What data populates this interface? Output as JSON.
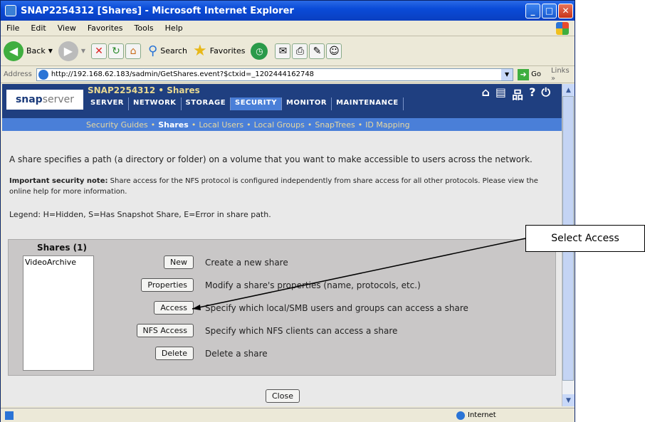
{
  "window": {
    "title": "SNAP2254312 [Shares] - Microsoft Internet Explorer"
  },
  "menu": [
    "File",
    "Edit",
    "View",
    "Favorites",
    "Tools",
    "Help"
  ],
  "toolbar": {
    "back": "Back",
    "search": "Search",
    "favorites": "Favorites"
  },
  "address": {
    "label": "Address",
    "url": "http://192.168.62.183/sadmin/GetShares.event?$ctxid=_1202444162748",
    "go": "Go",
    "links": "Links"
  },
  "snap": {
    "logo_bold": "snap",
    "logo_light": "server",
    "title": "SNAP2254312 • Shares",
    "nav": [
      "SERVER",
      "NETWORK",
      "STORAGE",
      "SECURITY",
      "MONITOR",
      "MAINTENANCE"
    ],
    "subnav": [
      "Security Guides",
      "Shares",
      "Local Users",
      "Local Groups",
      "SnapTrees",
      "ID Mapping"
    ],
    "subnav_sep": "•"
  },
  "page": {
    "intro": "A share specifies a path (a directory or folder) on a volume that you want to make accessible to users across the network.",
    "note_bold": "Important security note:",
    "note_text": " Share access for the NFS protocol is configured independently from share access for all other protocols. Please view the online help for more information.",
    "legend": "Legend: H=Hidden, S=Has Snapshot Share, E=Error in share path."
  },
  "shares": {
    "header": "Shares (1)",
    "items": [
      "VideoArchive"
    ]
  },
  "actions": [
    {
      "button": "New",
      "desc": "Create a new share"
    },
    {
      "button": "Properties",
      "desc": "Modify a share's properties (name, protocols, etc.)"
    },
    {
      "button": "Access",
      "desc": "Specify which local/SMB users and groups can access a share"
    },
    {
      "button": "NFS Access",
      "desc": "Specify which NFS clients can access a share"
    },
    {
      "button": "Delete",
      "desc": "Delete a share"
    }
  ],
  "close_button": "Close",
  "status": {
    "zone": "Internet"
  },
  "callout": "Select Access"
}
